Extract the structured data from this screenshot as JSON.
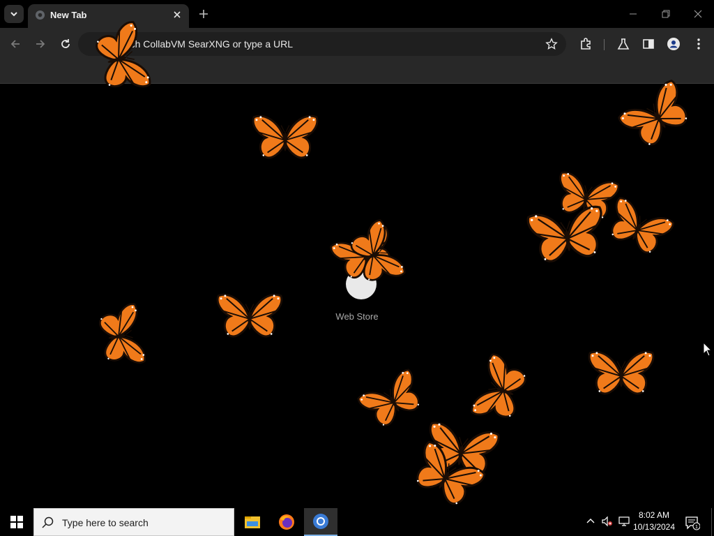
{
  "browser": {
    "tab_title": "New Tab",
    "omnibox_text": "Search CollabVM SearXNG or type a URL"
  },
  "page": {
    "shortcut_label": "Web Store"
  },
  "taskbar": {
    "search_placeholder": "Type here to search",
    "time": "8:02 AM",
    "date": "10/13/2024",
    "notification_count": "1"
  },
  "colors": {
    "chrome_bg": "#282828",
    "butterfly_orange": "#f07a1a",
    "butterfly_dark": "#1a0d05",
    "taskbar_accent": "#7fb3e8"
  },
  "icons": [
    "tab-search-icon",
    "globe-icon",
    "close-icon",
    "plus-icon",
    "minimize-icon",
    "restore-icon",
    "back-icon",
    "forward-icon",
    "reload-icon",
    "star-icon",
    "extensions-icon",
    "labs-icon",
    "side-panel-icon",
    "profile-icon",
    "menu-icon",
    "windows-icon",
    "search-icon",
    "file-explorer-icon",
    "firefox-icon",
    "chrome-icon",
    "chevron-up-icon",
    "volume-muted-icon",
    "network-icon",
    "notification-icon"
  ]
}
